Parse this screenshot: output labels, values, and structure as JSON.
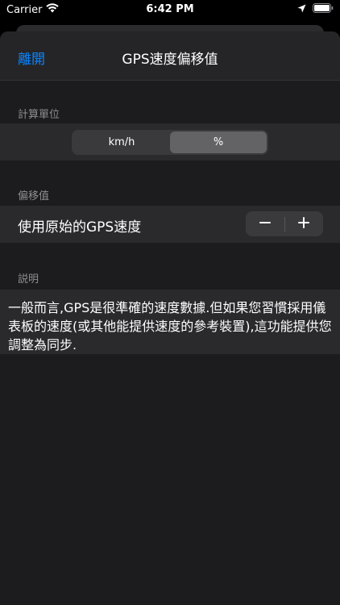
{
  "status_bar": {
    "carrier": "Carrier",
    "time": "6:42 PM"
  },
  "nav": {
    "back_label": "離開",
    "title": "GPS速度偏移值"
  },
  "unit_section": {
    "header": "計算單位",
    "segments": [
      {
        "label": "km/h",
        "selected": false
      },
      {
        "label": "%",
        "selected": true
      }
    ]
  },
  "offset_section": {
    "header": "偏移值",
    "row_label": "使用原始的GPS速度"
  },
  "description_section": {
    "header": "説明",
    "text": "一般而言,GPS是很準確的速度數據.但如果您習慣採用儀表板的速度(或其他能提供速度的參考裝置),這功能提供您調整為同步."
  },
  "colors": {
    "accent": "#0a84ff",
    "sheet_background": "#1c1c1e",
    "row_background": "#2a2a2c",
    "secondary_text": "#8e8e93"
  },
  "icons": {
    "wifi": "wifi-icon",
    "location": "location-arrow-icon",
    "battery": "battery-icon",
    "minus": "minus-icon",
    "plus": "plus-icon"
  }
}
